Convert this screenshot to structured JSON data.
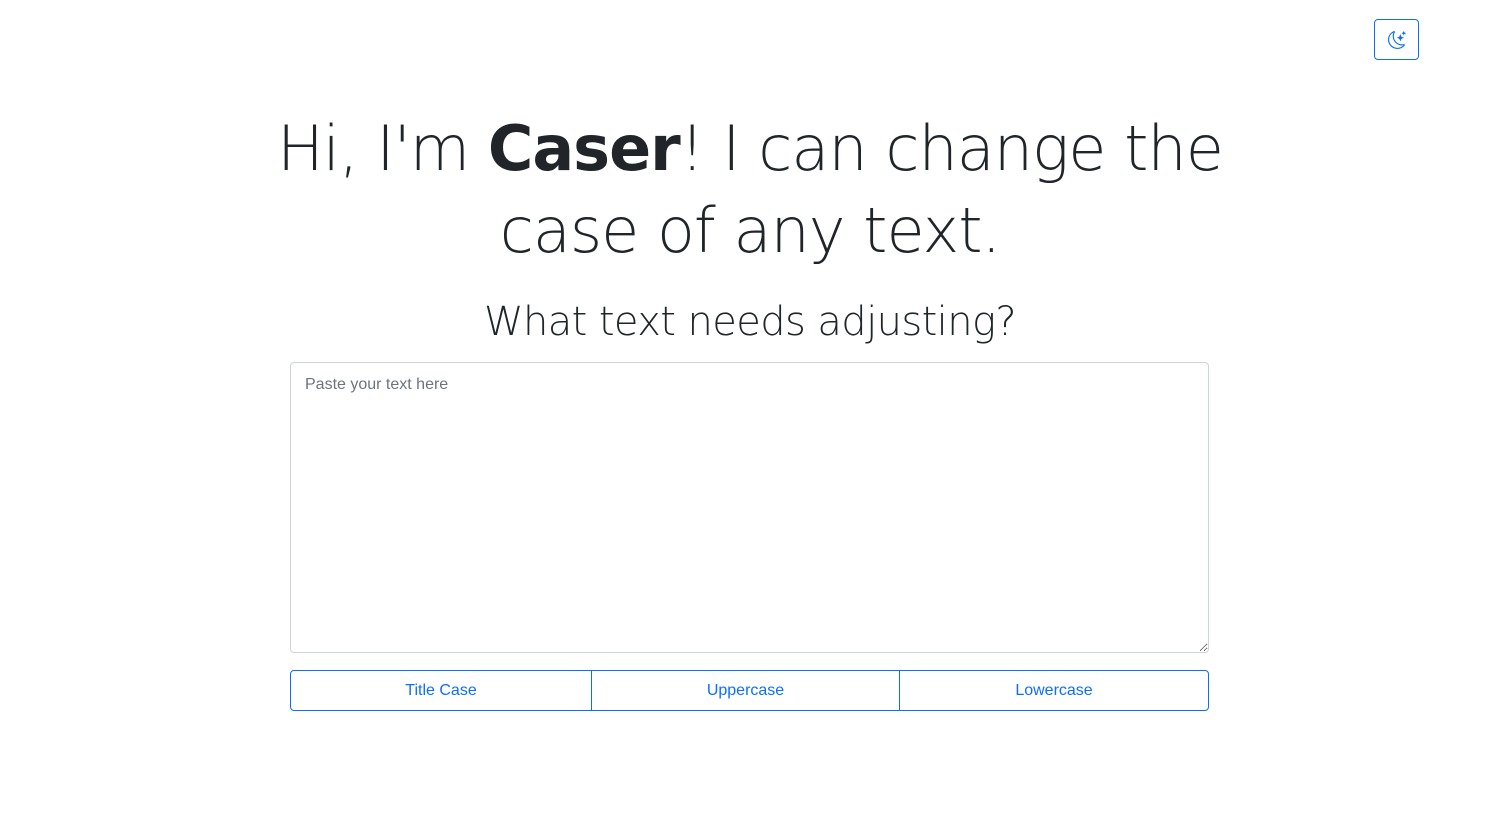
{
  "theme_toggle": {
    "icon": "moon-stars-icon",
    "accent_color": "#0d6efd"
  },
  "hero": {
    "headline_prefix": "Hi, I'm ",
    "headline_name": "Caser",
    "headline_suffix": "! I can change the case of any text.",
    "subheading": "What text needs adjusting?"
  },
  "editor": {
    "placeholder": "Paste your text here",
    "value": ""
  },
  "actions": {
    "title_case_label": "Title Case",
    "uppercase_label": "Uppercase",
    "lowercase_label": "Lowercase"
  }
}
